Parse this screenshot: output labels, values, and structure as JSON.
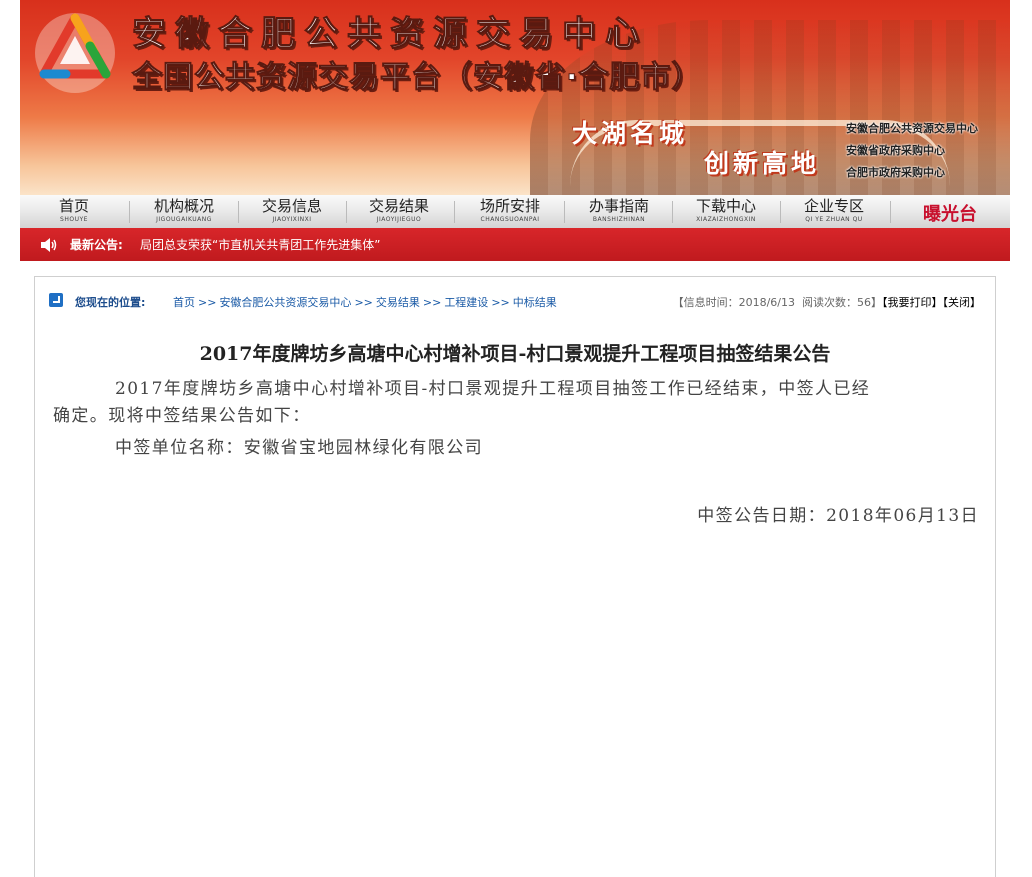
{
  "header": {
    "title_line1": "安徽合肥公共资源交易中心",
    "title_line2": "全国公共资源交易平台（安徽省·合肥市）",
    "slogan_line1": "大湖名城",
    "slogan_line2": "创新高地",
    "orgs": [
      "安徽合肥公共资源交易中心",
      "安徽省政府采购中心",
      "合肥市政府采购中心"
    ]
  },
  "nav": {
    "items": [
      {
        "label": "首页",
        "pinyin": "SHOUYE"
      },
      {
        "label": "机构概况",
        "pinyin": "JIGOUGAIKUANG"
      },
      {
        "label": "交易信息",
        "pinyin": "JIAOYIXINXI"
      },
      {
        "label": "交易结果",
        "pinyin": "JIAOYIJIEGUO"
      },
      {
        "label": "场所安排",
        "pinyin": "CHANGSUOANPAI"
      },
      {
        "label": "办事指南",
        "pinyin": "BANSHIZHINAN"
      },
      {
        "label": "下载中心",
        "pinyin": "XIAZAIZHONGXIN"
      },
      {
        "label": "企业专区",
        "pinyin": "QI YE ZHUAN QU"
      }
    ],
    "special": "曝光台"
  },
  "notice": {
    "label": "最新公告:",
    "text": "局团总支荣获“市直机关共青团工作先进集体”"
  },
  "breadcrumb": {
    "label": "您现在的位置:",
    "path": [
      "首页",
      "安徽合肥公共资源交易中心",
      "交易结果",
      "工程建设",
      "中标结果"
    ],
    "separator": ">>"
  },
  "meta": {
    "time_label": "【信息时间：",
    "time_value": "2018/6/13",
    "views_label": "阅读次数：",
    "views_value": "56",
    "close_bracket": "】",
    "print_label": "【我要打印】",
    "close_label": "【关闭】"
  },
  "article": {
    "title": "2017年度牌坊乡高塘中心村增补项目-村口景观提升工程项目抽签结果公告",
    "para1_line1": "2017年度牌坊乡高塘中心村增补项目-村口景观提升工程项目抽签工作已经结束，中签人已经",
    "para1_line2": "确定。现将中签结果公告如下：",
    "para2": "中签单位名称：安徽省宝地园林绿化有限公司",
    "date": "中签公告日期：2018年06月13日"
  }
}
